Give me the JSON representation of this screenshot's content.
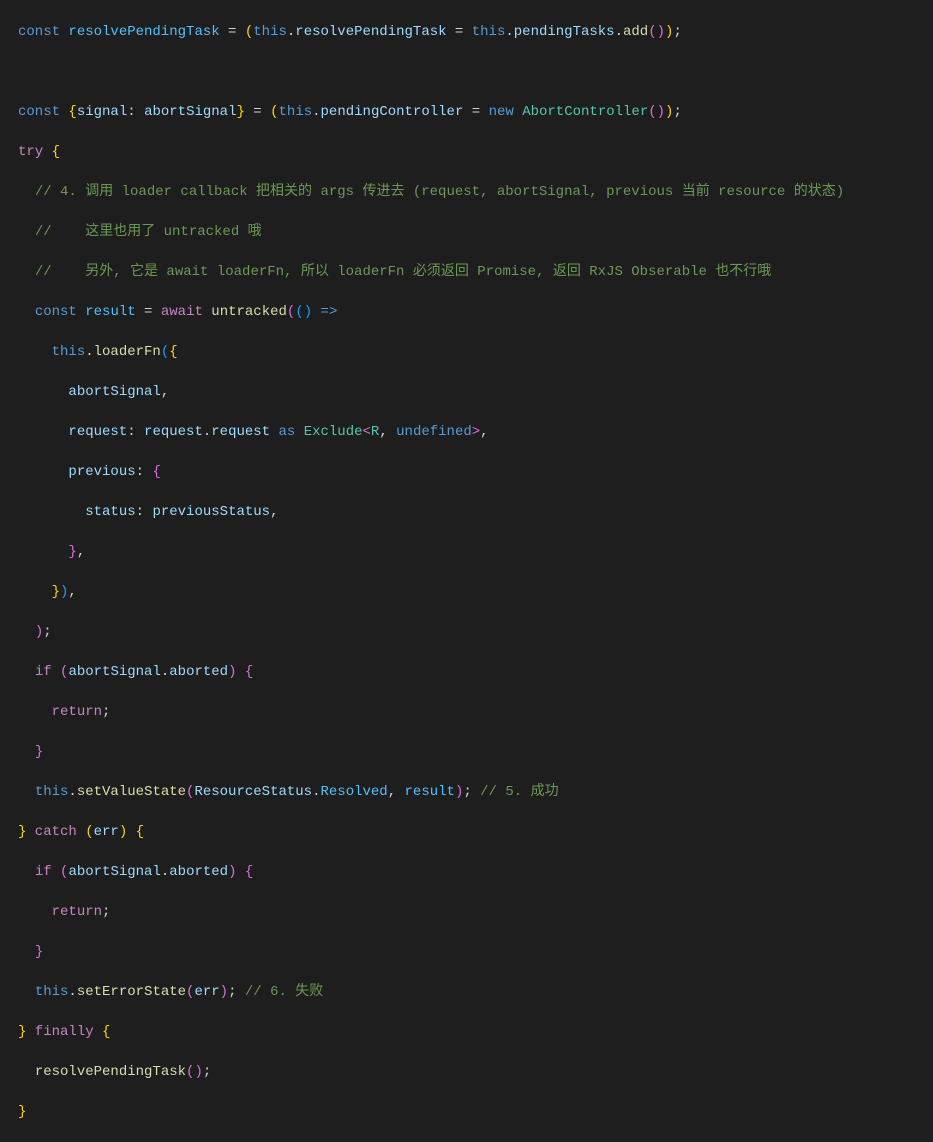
{
  "lines": {
    "l1_const": "const",
    "l1_resolvePendingTask": "resolvePendingTask",
    "l1_eq": " = ",
    "l1_p1": "(",
    "l1_this": "this",
    "l1_dot": ".",
    "l1_prop": "resolvePendingTask",
    "l1_eq2": " = ",
    "l1_this2": "this",
    "l1_prop2": "pendingTasks",
    "l1_add": "add",
    "l1_paren2": "()",
    "l1_close": ")",
    "l1_semi": ";",
    "l3_const": "const",
    "l3_brace": "{",
    "l3_signal": "signal",
    "l3_colon": ": ",
    "l3_abortSignal": "abortSignal",
    "l3_brace2": "}",
    "l3_eq": " = ",
    "l3_p1": "(",
    "l3_this": "this",
    "l3_dot": ".",
    "l3_prop": "pendingController",
    "l3_eq2": " = ",
    "l3_new": "new",
    "l3_cls": "AbortController",
    "l3_paren": "()",
    "l3_close": ")",
    "l3_semi": ";",
    "l4_try": "try",
    "l4_brace": " {",
    "l5_comment": "// 4. 调用 loader callback 把相关的 args 传进去 (request, abortSignal, previous 当前 resource 的状态)",
    "l6_comment": "//    这里也用了 untracked 哦",
    "l7_comment": "//    另外, 它是 await loaderFn, 所以 loaderFn 必须返回 Promise, 返回 RxJS Obserable 也不行哦",
    "l8_const": "const",
    "l8_result": "result",
    "l8_eq": " = ",
    "l8_await": "await",
    "l8_sp": " ",
    "l8_untracked": "untracked",
    "l8_p1": "(",
    "l8_p2": "(",
    "l8_p3": ")",
    "l8_arrow": " =>",
    "l9_this": "this",
    "l9_dot": ".",
    "l9_loaderFn": "loaderFn",
    "l9_p1": "(",
    "l9_brace": "{",
    "l10_abortSignal": "abortSignal",
    "l10_comma": ",",
    "l11_request": "request",
    "l11_colon": ": ",
    "l11_request2": "request",
    "l11_dot": ".",
    "l11_request3": "request",
    "l11_sp": " ",
    "l11_as": "as",
    "l11_sp2": " ",
    "l11_exclude": "Exclude",
    "l11_lt": "<",
    "l11_R": "R",
    "l11_comma": ", ",
    "l11_undef": "undefined",
    "l11_gt": ">",
    "l11_comma2": ",",
    "l12_previous": "previous",
    "l12_colon": ": ",
    "l12_brace": "{",
    "l13_status": "status",
    "l13_colon": ": ",
    "l13_prevStatus": "previousStatus",
    "l13_comma": ",",
    "l14_brace": "}",
    "l14_comma": ",",
    "l15_brace": "}",
    "l15_p": ")",
    "l15_comma": ",",
    "l16_p": ")",
    "l16_semi": ";",
    "l17_if": "if",
    "l17_sp": " ",
    "l17_p1": "(",
    "l17_abortSignal": "abortSignal",
    "l17_dot": ".",
    "l17_aborted": "aborted",
    "l17_p2": ")",
    "l17_brace": " {",
    "l18_return": "return",
    "l18_semi": ";",
    "l19_brace": "}",
    "l20_this": "this",
    "l20_dot": ".",
    "l20_setValueState": "setValueState",
    "l20_p1": "(",
    "l20_ResourceStatus": "ResourceStatus",
    "l20_dot2": ".",
    "l20_Resolved": "Resolved",
    "l20_comma": ", ",
    "l20_result": "result",
    "l20_p2": ")",
    "l20_semi": "; ",
    "l20_comment": "// 5. 成功",
    "l21_brace": "}",
    "l21_catch": " catch ",
    "l21_p1": "(",
    "l21_err": "err",
    "l21_p2": ")",
    "l21_brace2": " {",
    "l22_if": "if",
    "l22_sp": " ",
    "l22_p1": "(",
    "l22_abortSignal": "abortSignal",
    "l22_dot": ".",
    "l22_aborted": "aborted",
    "l22_p2": ")",
    "l22_brace": " {",
    "l23_return": "return",
    "l23_semi": ";",
    "l24_brace": "}",
    "l25_this": "this",
    "l25_dot": ".",
    "l25_setErrorState": "setErrorState",
    "l25_p1": "(",
    "l25_err": "err",
    "l25_p2": ")",
    "l25_semi": "; ",
    "l25_comment": "// 6. 失败",
    "l26_brace": "}",
    "l26_finally": " finally ",
    "l26_brace2": "{",
    "l27_resolvePendingTask": "resolvePendingTask",
    "l27_p": "()",
    "l27_semi": ";",
    "l28_brace": "}"
  }
}
